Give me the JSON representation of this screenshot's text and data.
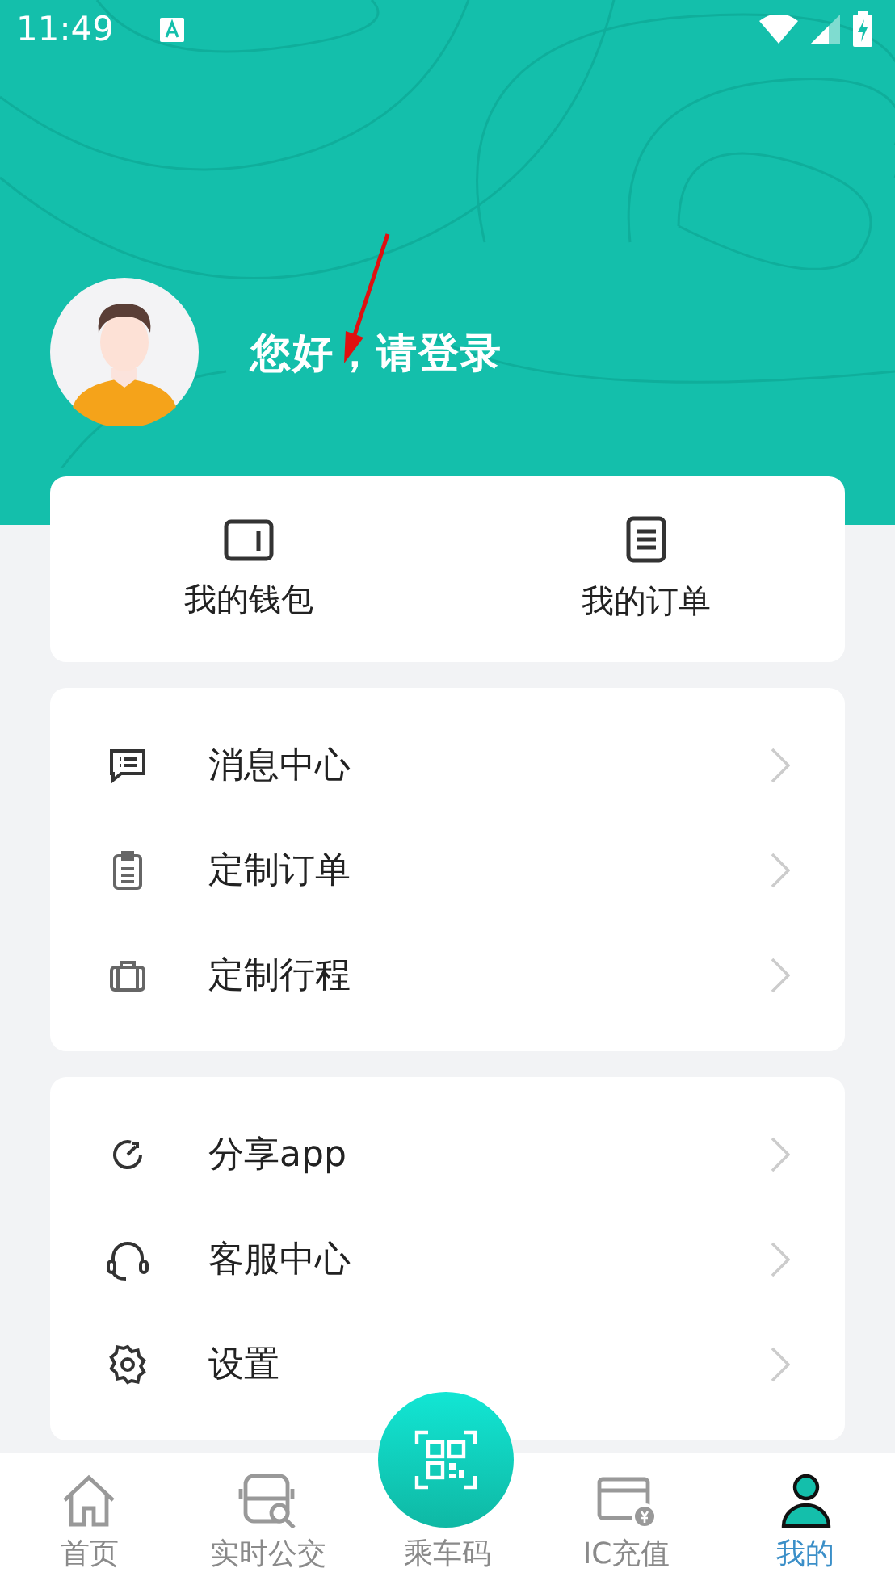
{
  "status_bar": {
    "time": "11:49"
  },
  "profile": {
    "greeting": "您好，请登录"
  },
  "quick_actions": [
    {
      "label": "我的钱包"
    },
    {
      "label": "我的订单"
    }
  ],
  "menu_groups": [
    [
      {
        "label": "消息中心"
      },
      {
        "label": "定制订单"
      },
      {
        "label": "定制行程"
      }
    ],
    [
      {
        "label": "分享app"
      },
      {
        "label": "客服中心"
      },
      {
        "label": "设置"
      }
    ]
  ],
  "tab_bar": [
    {
      "label": "首页",
      "selected": false
    },
    {
      "label": "实时公交",
      "selected": false
    },
    {
      "label": "乘车码",
      "selected": false
    },
    {
      "label": "IC充值",
      "selected": false
    },
    {
      "label": "我的",
      "selected": true
    }
  ]
}
